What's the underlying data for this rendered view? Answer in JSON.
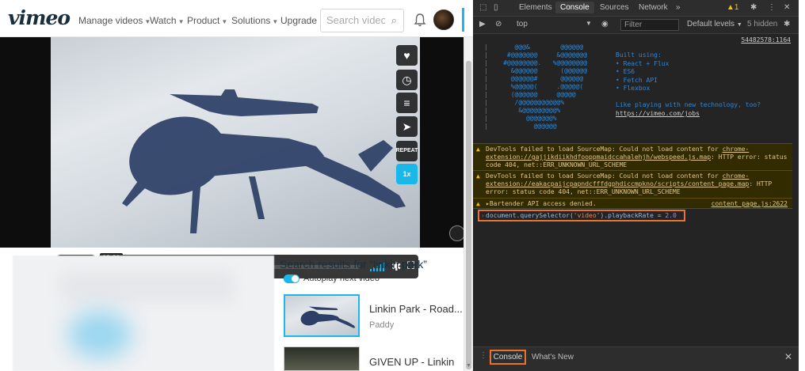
{
  "vimeo": {
    "logo": "vimeo",
    "nav": {
      "manage": "Manage videos",
      "watch": "Watch",
      "product": "Product",
      "solutions": "Solutions",
      "upgrade": "Upgrade"
    },
    "search_placeholder": "Search videos",
    "player": {
      "time": "03:01",
      "repeat_label": "REPEAT",
      "speed_label": "1x"
    },
    "sidebar": {
      "results_title": "Search results for “linkin park”",
      "autoplay_label": "Autoplay next video",
      "results": [
        {
          "title": "Linkin Park - Road...",
          "author": "Paddy"
        },
        {
          "title": "GIVEN UP - Linkin",
          "author": ""
        }
      ]
    }
  },
  "devtools": {
    "tabs": [
      "Elements",
      "Console",
      "Sources",
      "Network"
    ],
    "more_tabs": "»",
    "warning_count": "1",
    "toolbar": {
      "context": "top",
      "filter_placeholder": "Filter",
      "levels": "Default levels",
      "hidden": "5 hidden"
    },
    "console": {
      "source_top": "54482578:1164",
      "ascii_art": [
        "|       @@@&        @@@@@@",
        "|     #@@@@@@@     &@@@@@@@",
        "|    #@@@@@@@@.   %@@@@@@@@",
        "|      &@@@@@@      (@@@@@@",
        "|      @@@@@@#      @@@@@@",
        "|      %@@@@@(     .@@@@@(",
        "|      (@@@@@@     @@@@@",
        "|       /@@@@@@@@@@@%",
        "|        &@@@@@@@@@%",
        "|          @@@@@@@%",
        "|            @@@@@@"
      ],
      "info_lines": [
        "Built using:",
        "• React + Flux",
        "• ES6",
        "• Fetch API",
        "• Flexbox",
        "",
        "Like playing with new technology, too?"
      ],
      "jobs_link": "https://vimeo.com/jobs",
      "warnings": [
        {
          "prefix": "DevTools failed to load SourceMap: Could not load content for ",
          "link": "chrome-extension://gajjikdiikhdfooppmaidccahalehjh/webspeed.js.map",
          "suffix": ": HTTP error: status code 404, net::ERR_UNKNOWN_URL_SCHEME"
        },
        {
          "prefix": "DevTools failed to load SourceMap: Could not load content for ",
          "link": "chrome-extension://eakacpaijcpapndcfffdgphdiccmpkno/scripts/content_page.map",
          "suffix": ": HTTP error: status code 404, net::ERR_UNKNOWN_URL_SCHEME"
        }
      ],
      "bartender": {
        "text": "▸Bartender API access denied.",
        "source": "content_page.js:2622"
      },
      "command": {
        "prefix": "document.querySelector(",
        "selector": "'video'",
        "middle": ").playbackRate = ",
        "value": "2.0"
      }
    },
    "drawer": {
      "console_tab": "Console",
      "whatsnew_tab": "What's New"
    }
  }
}
